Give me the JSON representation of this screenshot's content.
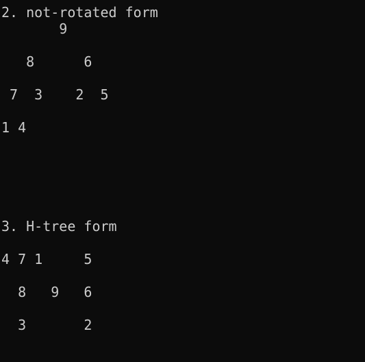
{
  "console": {
    "lines": [
      "2. not-rotated form",
      "       9",
      "   8      6",
      " 7  3    2  5",
      "1 4",
      "3. H-tree form",
      "4 7 1     5",
      "  8   9   6",
      "  3       2"
    ]
  },
  "colors": {
    "background": "#0c0c0c",
    "text": "#cccccc"
  }
}
